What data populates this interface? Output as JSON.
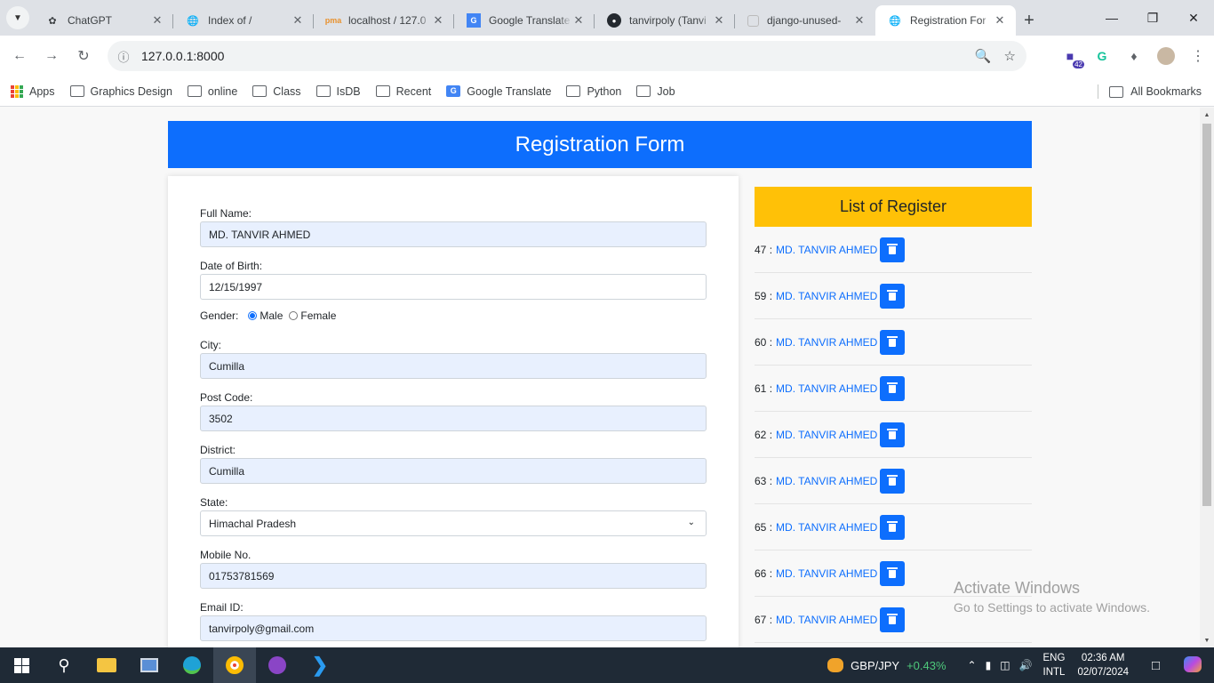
{
  "browser": {
    "tabs": [
      {
        "title": "ChatGPT",
        "favicon": "openai-icon"
      },
      {
        "title": "Index of /",
        "favicon": "globe-icon"
      },
      {
        "title": "localhost / 127.0",
        "favicon": "phpmyadmin-icon"
      },
      {
        "title": "Google Translate",
        "favicon": "google-translate-icon"
      },
      {
        "title": "tanvirpoly (Tanvi",
        "favicon": "github-icon"
      },
      {
        "title": "django-unused-",
        "favicon": "page-icon"
      },
      {
        "title": "Registration For",
        "favicon": "globe-icon",
        "active": true
      }
    ],
    "url": "127.0.0.1:8000",
    "extension_badge": "42",
    "bookmarks": [
      "Apps",
      "Graphics Design",
      "online",
      "Class",
      "IsDB",
      "Recent",
      "Google Translate",
      "Python",
      "Job"
    ],
    "all_bookmarks": "All Bookmarks"
  },
  "page": {
    "header": "Registration Form",
    "form": {
      "full_name_label": "Full Name:",
      "full_name": "MD. TANVIR AHMED",
      "dob_label": "Date of Birth:",
      "dob": "12/15/1997",
      "gender_label": "Gender:",
      "gender_options": [
        "Male",
        "Female"
      ],
      "gender_selected": "Male",
      "city_label": "City:",
      "city": "Cumilla",
      "post_code_label": "Post Code:",
      "post_code": "3502",
      "district_label": "District:",
      "district": "Cumilla",
      "state_label": "State:",
      "state": "Himachal Pradesh",
      "mobile_label": "Mobile No.",
      "mobile": "01753781569",
      "email_label": "Email ID:",
      "email": "tanvirpoly@gmail.com"
    },
    "list": {
      "title": "List of Register",
      "items": [
        {
          "id": "47",
          "name": "MD. TANVIR AHMED"
        },
        {
          "id": "59",
          "name": "MD. TANVIR AHMED"
        },
        {
          "id": "60",
          "name": "MD. TANVIR AHMED"
        },
        {
          "id": "61",
          "name": "MD. TANVIR AHMED"
        },
        {
          "id": "62",
          "name": "MD. TANVIR AHMED"
        },
        {
          "id": "63",
          "name": "MD. TANVIR AHMED"
        },
        {
          "id": "65",
          "name": "MD. TANVIR AHMED"
        },
        {
          "id": "66",
          "name": "MD. TANVIR AHMED"
        },
        {
          "id": "67",
          "name": "MD. TANVIR AHMED"
        }
      ]
    },
    "colors": {
      "header": "#0d6efd",
      "list_header": "#ffc107",
      "button": "#0d6efd"
    }
  },
  "watermark": {
    "line1": "Activate Windows",
    "line2": "Go to Settings to activate Windows."
  },
  "taskbar": {
    "fx_pair": "GBP/JPY",
    "fx_change": "+0.43%",
    "lang_line1": "ENG",
    "lang_line2": "INTL",
    "time": "02:36 AM",
    "date": "02/07/2024"
  }
}
